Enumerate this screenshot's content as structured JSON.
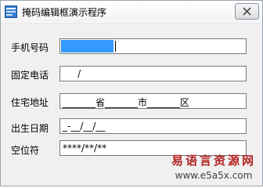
{
  "window": {
    "title": "掩码编辑框演示程序",
    "icon": "app-window-icon",
    "close_icon": "close-icon"
  },
  "form": {
    "fields": [
      {
        "label": "手机号码",
        "value": "",
        "state": "selected"
      },
      {
        "label": "固定电话",
        "value": "     /"
      },
      {
        "label": "住宅地址",
        "value": "_______省_______市_______区"
      },
      {
        "label": "出生日期",
        "value": "_-__/__/__"
      },
      {
        "label": "空位符",
        "value": "****/**/**"
      }
    ]
  },
  "watermark": {
    "text": "易语言资源网",
    "url": "www.e5a5x.com"
  }
}
